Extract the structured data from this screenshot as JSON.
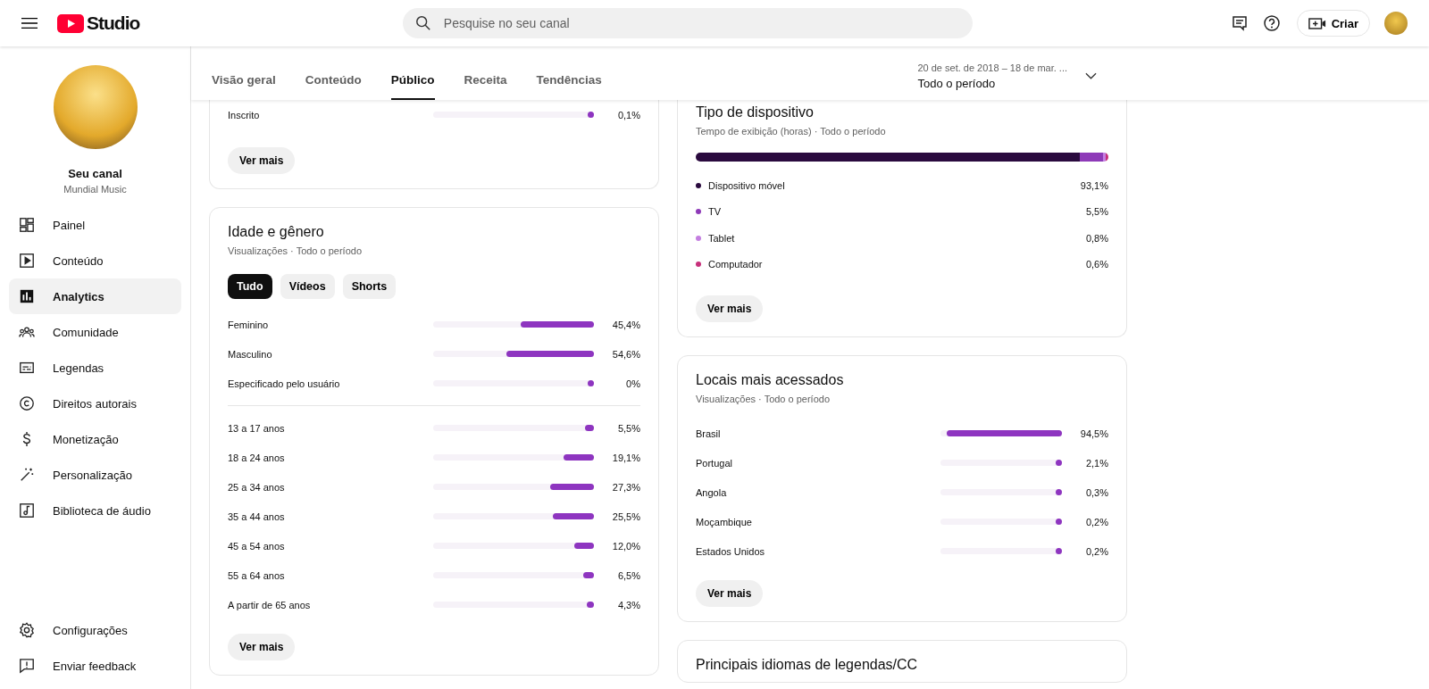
{
  "header": {
    "logo_text": "Studio",
    "search": {
      "placeholder": "Pesquise no seu canal"
    },
    "create_button": "Criar"
  },
  "sidebar": {
    "channel_title": "Seu canal",
    "channel_name": "Mundial Music",
    "items": [
      {
        "label": "Painel",
        "selected": false
      },
      {
        "label": "Conteúdo",
        "selected": false
      },
      {
        "label": "Analytics",
        "selected": true
      },
      {
        "label": "Comunidade",
        "selected": false
      },
      {
        "label": "Legendas",
        "selected": false
      },
      {
        "label": "Direitos autorais",
        "selected": false
      },
      {
        "label": "Monetização",
        "selected": false
      },
      {
        "label": "Personalização",
        "selected": false
      },
      {
        "label": "Biblioteca de áudio",
        "selected": false
      }
    ],
    "bottom_items": [
      {
        "label": "Configurações"
      },
      {
        "label": "Enviar feedback"
      }
    ]
  },
  "tabs": [
    {
      "label": "Visão geral",
      "selected": false
    },
    {
      "label": "Conteúdo",
      "selected": false
    },
    {
      "label": "Público",
      "selected": true
    },
    {
      "label": "Receita",
      "selected": false
    },
    {
      "label": "Tendências",
      "selected": false
    }
  ],
  "date_range": {
    "range": "20 de set. de 2018 – 18 de mar. ...",
    "period": "Todo o período"
  },
  "subscription_card": {
    "rows": [
      {
        "label": "Inscrito",
        "value": "0,1%",
        "level": 0.001
      }
    ],
    "more_button": "Ver mais"
  },
  "age_gender_card": {
    "title": "Idade e gênero",
    "subtitle": "Visualizações · Todo o período",
    "filters": [
      {
        "label": "Tudo",
        "selected": true
      },
      {
        "label": "Vídeos",
        "selected": false
      },
      {
        "label": "Shorts",
        "selected": false
      }
    ],
    "gender_rows": [
      {
        "label": "Feminino",
        "value": "45,4%",
        "level": 0.454
      },
      {
        "label": "Masculino",
        "value": "54,6%",
        "level": 0.546
      },
      {
        "label": "Especificado pelo usuário",
        "value": "0%",
        "level": 0
      }
    ],
    "age_rows": [
      {
        "label": "13 a 17 anos",
        "value": "5,5%",
        "level": 0.055
      },
      {
        "label": "18 a 24 anos",
        "value": "19,1%",
        "level": 0.191
      },
      {
        "label": "25 a 34 anos",
        "value": "27,3%",
        "level": 0.273
      },
      {
        "label": "35 a 44 anos",
        "value": "25,5%",
        "level": 0.255
      },
      {
        "label": "45 a 54 anos",
        "value": "12,0%",
        "level": 0.12
      },
      {
        "label": "55 a 64 anos",
        "value": "6,5%",
        "level": 0.065
      },
      {
        "label": "A partir de 65 anos",
        "value": "4,3%",
        "level": 0.043
      }
    ],
    "more_button": "Ver mais"
  },
  "device_card": {
    "title": "Tipo de dispositivo",
    "subtitle": "Tempo de exibição (horas) · Todo o período",
    "devices": [
      {
        "label": "Dispositivo móvel",
        "value": "93,1%",
        "level": 0.931,
        "color": "#2a0a3e"
      },
      {
        "label": "TV",
        "value": "5,5%",
        "level": 0.055,
        "color": "#8e3ab8"
      },
      {
        "label": "Tablet",
        "value": "0,8%",
        "level": 0.008,
        "color": "#c47fe0"
      },
      {
        "label": "Computador",
        "value": "0,6%",
        "level": 0.006,
        "color": "#c7307b"
      }
    ],
    "more_button": "Ver mais"
  },
  "locations_card": {
    "title": "Locais mais acessados",
    "subtitle": "Visualizações · Todo o período",
    "rows": [
      {
        "label": "Brasil",
        "value": "94,5%",
        "level": 0.945
      },
      {
        "label": "Portugal",
        "value": "2,1%",
        "level": 0.021
      },
      {
        "label": "Angola",
        "value": "0,3%",
        "level": 0.003
      },
      {
        "label": "Moçambique",
        "value": "0,2%",
        "level": 0.002
      },
      {
        "label": "Estados Unidos",
        "value": "0,2%",
        "level": 0.002
      }
    ],
    "more_button": "Ver mais"
  },
  "languages_card": {
    "title": "Principais idiomas de legendas/CC"
  }
}
